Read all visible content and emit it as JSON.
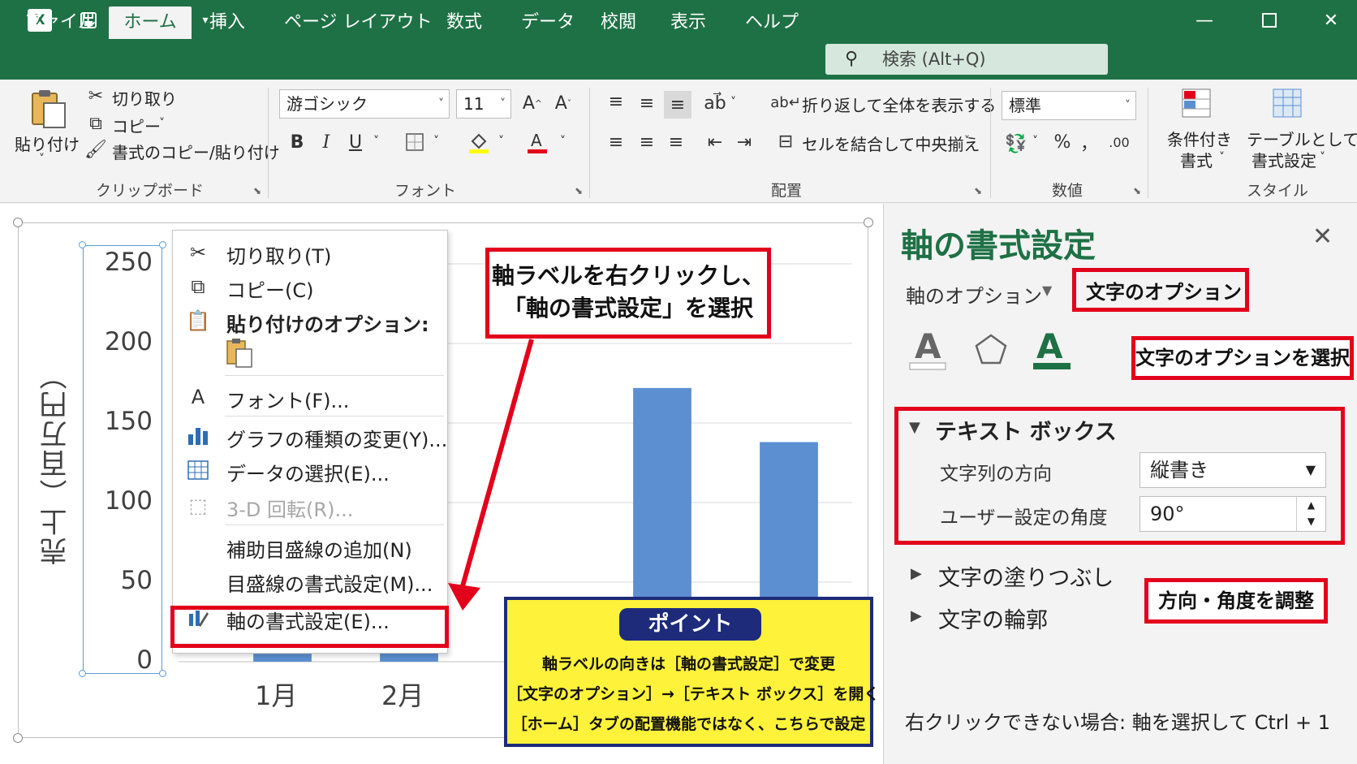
{
  "titlebar": {
    "app_logo": "X",
    "icons": [
      "save-icon",
      "undo-icon",
      "redo-icon",
      "customize-icon"
    ],
    "window_controls": [
      "minimize-icon",
      "maximize-icon",
      "close-icon"
    ]
  },
  "tabs": [
    {
      "label": "ファイル",
      "active": false
    },
    {
      "label": "ホーム",
      "active": true
    },
    {
      "label": "挿入",
      "active": false
    },
    {
      "label": "ページ レイアウト",
      "active": false
    },
    {
      "label": "数式",
      "active": false
    },
    {
      "label": "データ",
      "active": false
    },
    {
      "label": "校閲",
      "active": false
    },
    {
      "label": "表示",
      "active": false
    },
    {
      "label": "ヘルプ",
      "active": false
    }
  ],
  "search": {
    "placeholder": "検索 (Alt+Q)"
  },
  "ribbon": {
    "clipboard": {
      "paste": "貼り付け",
      "cut": "切り取り",
      "copy": "コピー",
      "format_painter": "書式のコピー/貼り付け",
      "group_label": "クリップボード"
    },
    "font": {
      "font_name": "游ゴシック",
      "font_size": "11",
      "bold": "B",
      "italic": "I",
      "underline": "U",
      "group_label": "フォント"
    },
    "alignment": {
      "wrap_text": "折り返して全体を表示する",
      "merge_center": "セルを結合して中央揃え",
      "group_label": "配置"
    },
    "number": {
      "format": "標準",
      "percent": "%",
      "comma": "，",
      "group_label": "数値"
    },
    "styles": {
      "conditional_line1": "条件付き",
      "conditional_line2": "書式",
      "table_line1": "テーブルとして",
      "table_line2": "書式設定",
      "group_label": "スタイル"
    }
  },
  "chart_data": {
    "type": "bar",
    "categories": [
      "1月",
      "2月",
      "",
      "",
      ""
    ],
    "values": [
      5,
      160,
      0,
      172,
      138
    ],
    "ylabel": "売上（百万円）",
    "ylim": [
      0,
      250
    ],
    "yticks": [
      "250",
      "200",
      "150",
      "100",
      "50",
      "0"
    ],
    "grid": true
  },
  "context_menu": {
    "items": [
      {
        "icon": "scissors-icon",
        "label": "切り取り(T)"
      },
      {
        "icon": "copy-icon",
        "label": "コピー(C)"
      },
      {
        "icon": "paste-icon",
        "label": "貼り付けのオプション:"
      },
      {
        "icon": "font-icon",
        "label": "フォント(F)..."
      },
      {
        "icon": "chart-type-icon",
        "label": "グラフの種類の変更(Y)..."
      },
      {
        "icon": "select-data-icon",
        "label": "データの選択(E)..."
      },
      {
        "icon": "rotate-3d-icon",
        "label": "3-D 回転(R)..."
      },
      {
        "icon": "",
        "label": "補助目盛線の追加(N)"
      },
      {
        "icon": "",
        "label": "目盛線の書式設定(M)..."
      },
      {
        "icon": "format-axis-icon",
        "label": "軸の書式設定(E)..."
      }
    ]
  },
  "callouts": {
    "right_click_line1": "軸ラベルを右クリックし、",
    "right_click_line2": "「軸の書式設定」を選択",
    "text_options": "文字のオプションを選択",
    "adjust": "方向・角度を調整"
  },
  "point": {
    "title": "ポイント",
    "lines": [
      "軸ラベルの向きは［軸の書式設定］で変更",
      "［文字のオプション］→［テキスト ボックス］を開く",
      "［ホーム］タブの配置機能ではなく、こちらで設定"
    ]
  },
  "pane": {
    "title": "軸の書式設定",
    "tab_axis_options": "軸のオプション",
    "tab_text_options": "文字のオプション",
    "section_textbox": "テキスト ボックス",
    "direction_label": "文字列の方向",
    "direction_value": "縦書き",
    "angle_label": "ユーザー設定の角度",
    "angle_value": "90°",
    "section_fill": "文字の塗りつぶし",
    "section_outline": "文字の輪郭",
    "note": "右クリックできない場合: 軸を選択して Ctrl + 1"
  },
  "colors": {
    "excel_green": "#1e7145",
    "bar_blue": "#5b8fd1",
    "callout_red": "#e3001b",
    "point_yellow": "#fff23a",
    "point_navy": "#1d2b7a"
  }
}
